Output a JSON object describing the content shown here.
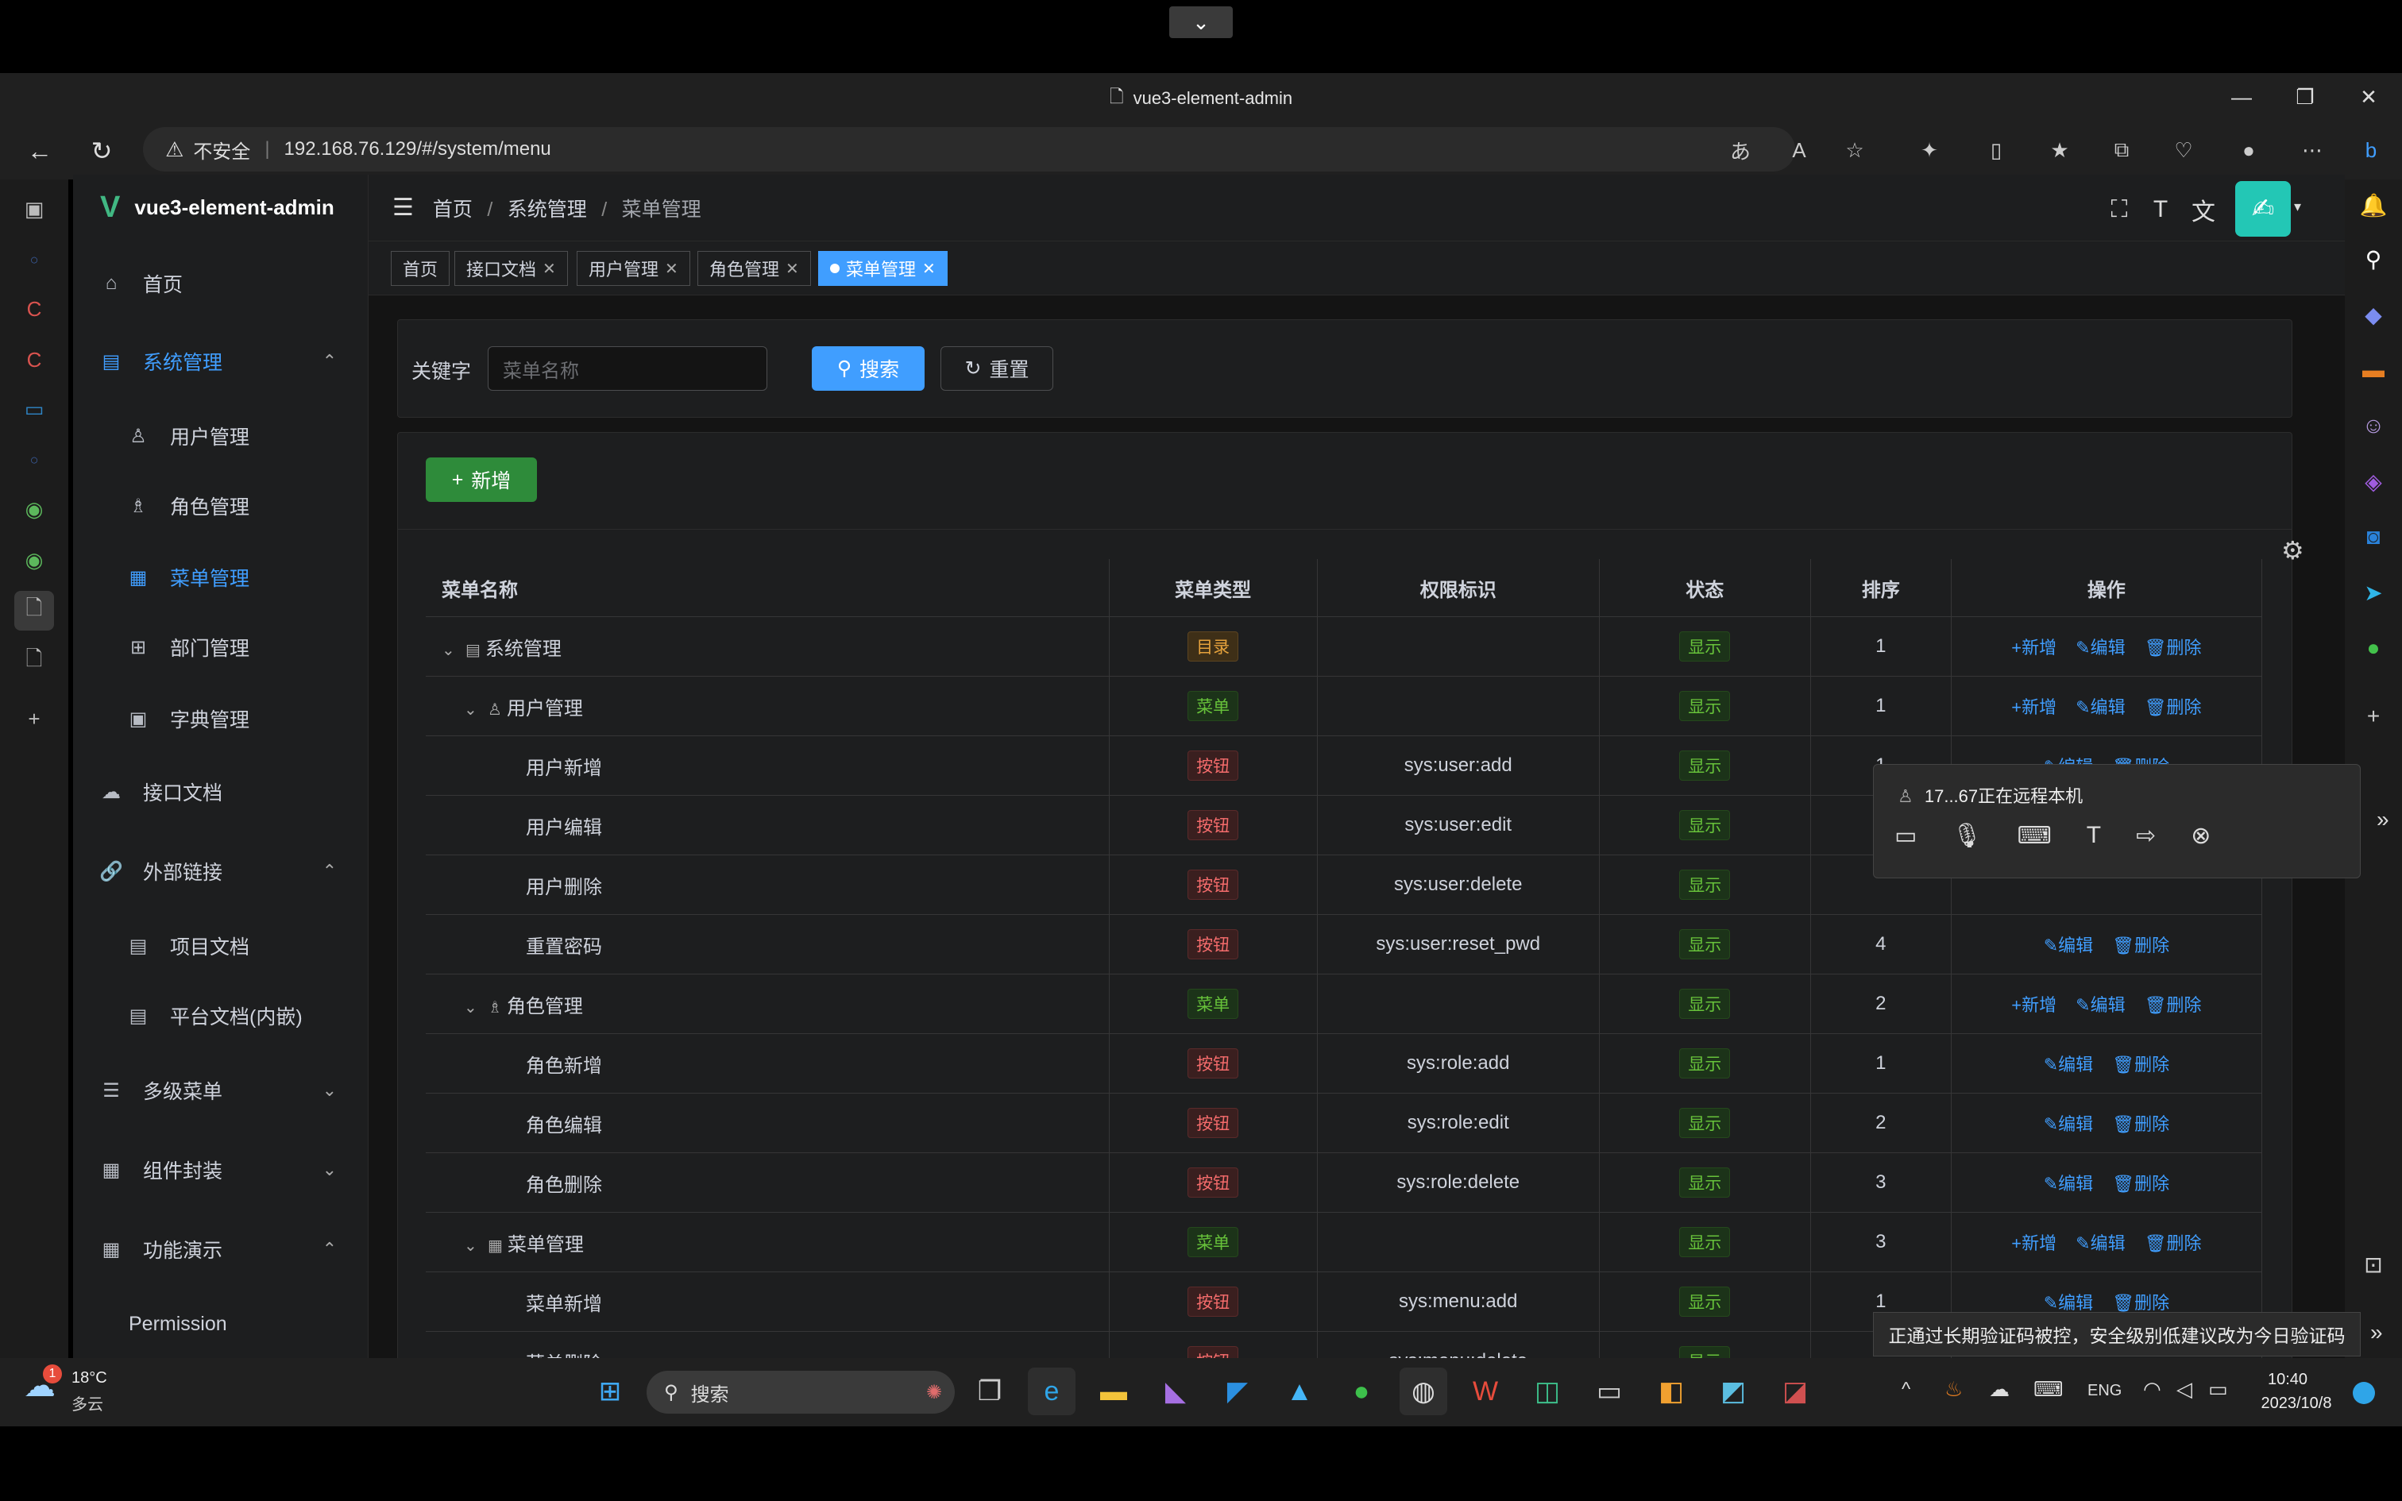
{
  "browser": {
    "title": "vue3-element-admin",
    "security_label": "不安全",
    "url": "192.168.76.129/#/system/menu"
  },
  "app": {
    "logo_text": "vue3-element-admin",
    "breadcrumb": [
      "首页",
      "系统管理",
      "菜单管理"
    ],
    "menu": [
      {
        "label": "首页",
        "icon": "home-icon",
        "arrow": ""
      },
      {
        "label": "系统管理",
        "icon": "system-icon",
        "arrow": "⌃"
      },
      {
        "label": "用户管理",
        "icon": "user-icon",
        "arrow": ""
      },
      {
        "label": "角色管理",
        "icon": "role-icon",
        "arrow": ""
      },
      {
        "label": "菜单管理",
        "icon": "menu-icon",
        "arrow": ""
      },
      {
        "label": "部门管理",
        "icon": "tree-icon",
        "arrow": ""
      },
      {
        "label": "字典管理",
        "icon": "dict-icon",
        "arrow": ""
      },
      {
        "label": "接口文档",
        "icon": "api-icon",
        "arrow": ""
      },
      {
        "label": "外部链接",
        "icon": "link-icon",
        "arrow": "⌃"
      },
      {
        "label": "项目文档",
        "icon": "doc-icon",
        "arrow": ""
      },
      {
        "label": "平台文档(内嵌)",
        "icon": "doc-icon",
        "arrow": ""
      },
      {
        "label": "多级菜单",
        "icon": "multilevel-icon",
        "arrow": "⌄"
      },
      {
        "label": "组件封装",
        "icon": "component-icon",
        "arrow": "⌄"
      },
      {
        "label": "功能演示",
        "icon": "demo-icon",
        "arrow": "⌃"
      },
      {
        "label": "Permission",
        "icon": "",
        "arrow": ""
      }
    ],
    "tags": [
      {
        "label": "首页"
      },
      {
        "label": "接口文档"
      },
      {
        "label": "用户管理"
      },
      {
        "label": "角色管理"
      },
      {
        "label": "菜单管理"
      }
    ],
    "search": {
      "label": "关键字",
      "placeholder": "菜单名称",
      "search_btn": "搜索",
      "reset_btn": "重置"
    },
    "add_btn": "新增",
    "table": {
      "headers": [
        "菜单名称",
        "菜单类型",
        "权限标识",
        "状态",
        "排序",
        "操作"
      ],
      "rows": [
        {
          "name": "系统管理",
          "level": 0,
          "expand": true,
          "icon": "system-icon",
          "type": "目录",
          "type_kind": "warn",
          "perm": "",
          "status": "显示",
          "sort": "1",
          "actions": [
            "新增",
            "编辑",
            "删除"
          ]
        },
        {
          "name": "用户管理",
          "level": 1,
          "expand": true,
          "icon": "user-icon",
          "type": "菜单",
          "type_kind": "succ",
          "perm": "",
          "status": "显示",
          "sort": "1",
          "actions": [
            "新增",
            "编辑",
            "删除"
          ]
        },
        {
          "name": "用户新增",
          "level": 2,
          "expand": false,
          "icon": "",
          "type": "按钮",
          "type_kind": "dang",
          "perm": "sys:user:add",
          "status": "显示",
          "sort": "1",
          "actions": [
            "编辑",
            "删除"
          ]
        },
        {
          "name": "用户编辑",
          "level": 2,
          "expand": false,
          "icon": "",
          "type": "按钮",
          "type_kind": "dang",
          "perm": "sys:user:edit",
          "status": "显示",
          "sort": "",
          "actions": []
        },
        {
          "name": "用户删除",
          "level": 2,
          "expand": false,
          "icon": "",
          "type": "按钮",
          "type_kind": "dang",
          "perm": "sys:user:delete",
          "status": "显示",
          "sort": "",
          "actions": []
        },
        {
          "name": "重置密码",
          "level": 2,
          "expand": false,
          "icon": "",
          "type": "按钮",
          "type_kind": "dang",
          "perm": "sys:user:reset_pwd",
          "status": "显示",
          "sort": "4",
          "actions": [
            "编辑",
            "删除"
          ]
        },
        {
          "name": "角色管理",
          "level": 1,
          "expand": true,
          "icon": "role-icon",
          "type": "菜单",
          "type_kind": "succ",
          "perm": "",
          "status": "显示",
          "sort": "2",
          "actions": [
            "新增",
            "编辑",
            "删除"
          ]
        },
        {
          "name": "角色新增",
          "level": 2,
          "expand": false,
          "icon": "",
          "type": "按钮",
          "type_kind": "dang",
          "perm": "sys:role:add",
          "status": "显示",
          "sort": "1",
          "actions": [
            "编辑",
            "删除"
          ]
        },
        {
          "name": "角色编辑",
          "level": 2,
          "expand": false,
          "icon": "",
          "type": "按钮",
          "type_kind": "dang",
          "perm": "sys:role:edit",
          "status": "显示",
          "sort": "2",
          "actions": [
            "编辑",
            "删除"
          ]
        },
        {
          "name": "角色删除",
          "level": 2,
          "expand": false,
          "icon": "",
          "type": "按钮",
          "type_kind": "dang",
          "perm": "sys:role:delete",
          "status": "显示",
          "sort": "3",
          "actions": [
            "编辑",
            "删除"
          ]
        },
        {
          "name": "菜单管理",
          "level": 1,
          "expand": true,
          "icon": "menu-icon",
          "type": "菜单",
          "type_kind": "succ",
          "perm": "",
          "status": "显示",
          "sort": "3",
          "actions": [
            "新增",
            "编辑",
            "删除"
          ]
        },
        {
          "name": "菜单新增",
          "level": 2,
          "expand": false,
          "icon": "",
          "type": "按钮",
          "type_kind": "dang",
          "perm": "sys:menu:add",
          "status": "显示",
          "sort": "1",
          "actions": [
            "编辑",
            "删除"
          ]
        },
        {
          "name": "菜单删除",
          "level": 2,
          "expand": false,
          "icon": "",
          "type": "按钮",
          "type_kind": "dang",
          "perm": "sys:menu:delete",
          "status": "显示",
          "sort": "",
          "actions": []
        }
      ]
    }
  },
  "remote_popup": {
    "text": "17...67正在远程本机"
  },
  "notification": {
    "text": "正通过长期验证码被控，安全级别低建议改为今日验证码"
  },
  "taskbar": {
    "weather_temp": "18°C",
    "weather_desc": "多云",
    "weather_badge": "1",
    "search_label": "搜索",
    "lang": "ENG",
    "time": "10:40",
    "date": "2023/10/8"
  },
  "colors": {
    "accent": "#409eff",
    "success": "#67c23a",
    "warning": "#e6a23c",
    "danger": "#f56c6c",
    "add_button": "#2e8b3a"
  }
}
